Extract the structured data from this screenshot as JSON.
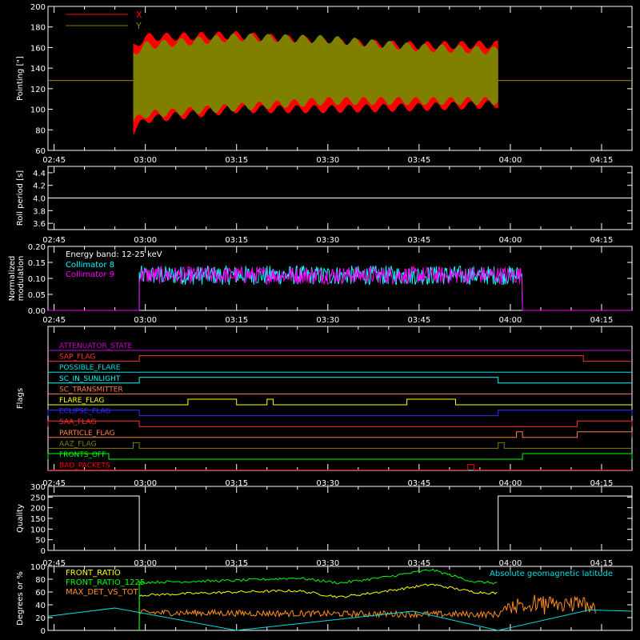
{
  "chart_data": [
    {
      "type": "area",
      "ylabel": "Pointing [\"]",
      "ylim": [
        60,
        200
      ],
      "yticks": [
        60,
        80,
        100,
        120,
        140,
        160,
        180,
        200
      ],
      "x_tick_labels": [
        "02:45",
        "03:00",
        "03:15",
        "03:30",
        "03:45",
        "04:00",
        "04:15"
      ],
      "legend_position": "top-left",
      "series": [
        {
          "name": "X",
          "color": "#ff0000",
          "baseline": 128,
          "envelope": {
            "x": [
              "02:58",
              "03:00",
              "03:15",
              "03:30",
              "03:45",
              "03:58"
            ],
            "upper": [
              160,
              170,
              172,
              165,
              162,
              163
            ],
            "lower": [
              78,
              90,
              100,
              100,
              102,
              105
            ]
          }
        },
        {
          "name": "Y",
          "color": "#808000",
          "baseline": 128,
          "envelope": {
            "x": [
              "02:58",
              "03:00",
              "03:15",
              "03:30",
              "03:45",
              "03:58"
            ],
            "upper": [
              155,
              162,
              170,
              168,
              160,
              157
            ],
            "lower": [
              88,
              95,
              102,
              108,
              108,
              108
            ]
          }
        }
      ]
    },
    {
      "type": "line",
      "ylabel": "Roll period [s]",
      "ylim": [
        3.5,
        4.5
      ],
      "yticks": [
        "3.6",
        "3.8",
        "4.0",
        "4.2",
        "4.4"
      ],
      "x_tick_labels": [
        "02:45",
        "03:00",
        "03:15",
        "03:30",
        "03:45",
        "04:00",
        "04:15"
      ],
      "series": [
        {
          "color": "#ffffff",
          "value": 4.0
        }
      ]
    },
    {
      "type": "line",
      "ylabel": "Normalized modulation",
      "ylim": [
        0,
        0.2
      ],
      "yticks": [
        "0.00",
        "0.05",
        "0.10",
        "0.15",
        "0.20"
      ],
      "x_tick_labels": [
        "02:45",
        "03:00",
        "03:15",
        "03:30",
        "03:45",
        "04:00",
        "04:15"
      ],
      "annotation": "Energy band: 12-25 keV",
      "series": [
        {
          "name": "Collimator 8",
          "color": "#00ffff",
          "mean": 0.11,
          "range": [
            0.08,
            0.19
          ],
          "x_range": [
            "02:59",
            "04:02"
          ]
        },
        {
          "name": "Collimator 9",
          "color": "#ff00ff",
          "mean": 0.11,
          "range": [
            0.07,
            0.17
          ],
          "x_range": [
            "02:59",
            "04:02"
          ]
        }
      ]
    },
    {
      "type": "line",
      "ylabel": "Flags",
      "x_tick_labels": [
        "02:45",
        "03:00",
        "03:15",
        "03:30",
        "03:45",
        "04:00",
        "04:15"
      ],
      "series": [
        {
          "name": "ATTENUATOR_STATE",
          "color": "#cc00cc",
          "steps": []
        },
        {
          "name": "SAP_FLAG",
          "color": "#ff3030",
          "steps": [
            [
              "02:59",
              "04:12"
            ]
          ]
        },
        {
          "name": "POSSIBLE_FLARE",
          "color": "#00e0e0",
          "steps": []
        },
        {
          "name": "SC_IN_SUNLIGHT",
          "color": "#00ffff",
          "steps": [
            [
              "02:59",
              "03:58"
            ]
          ]
        },
        {
          "name": "SC_TRANSMITTER",
          "color": "#ff8040",
          "steps": []
        },
        {
          "name": "FLARE_FLAG",
          "color": "#ffff00",
          "steps": [
            [
              "03:07",
              "03:15"
            ],
            [
              "03:20",
              "03:21"
            ],
            [
              "03:43",
              "03:51"
            ]
          ]
        },
        {
          "name": "ECLIPSE_FLAG",
          "color": "#3030ff",
          "steps": [
            [
              "02:44",
              "02:59"
            ],
            [
              "03:58",
              "04:20"
            ]
          ]
        },
        {
          "name": "SAA_FLAG",
          "color": "#ff3030",
          "steps": [
            [
              "02:44",
              "02:59"
            ],
            [
              "04:11",
              "04:20"
            ]
          ]
        },
        {
          "name": "PARTICLE_FLAG",
          "color": "#ff8040",
          "steps": [
            [
              "04:01",
              "04:02"
            ],
            [
              "04:11",
              "04:20"
            ]
          ]
        },
        {
          "name": "AAZ_FLAG",
          "color": "#808000",
          "steps": [
            [
              "02:58",
              "02:59"
            ],
            [
              "03:58",
              "03:59"
            ]
          ]
        },
        {
          "name": "FRONTS_OFF",
          "color": "#00ff00",
          "steps": [
            [
              "02:44",
              "02:54"
            ],
            [
              "04:02",
              "04:20"
            ]
          ]
        },
        {
          "name": "BAD_PACKETS",
          "color": "#ff0000",
          "steps": [
            [
              "03:53",
              "03:54"
            ]
          ]
        }
      ]
    },
    {
      "type": "line",
      "ylabel": "Quality",
      "ylim": [
        0,
        300
      ],
      "yticks": [
        0,
        50,
        100,
        150,
        200,
        250,
        300
      ],
      "x_tick_labels": [
        "02:45",
        "03:00",
        "03:15",
        "03:30",
        "03:45",
        "04:00",
        "04:15"
      ],
      "series": [
        {
          "color": "#ffffff",
          "x": [
            "02:44",
            "02:59",
            "02:59",
            "03:58",
            "03:58",
            "04:20"
          ],
          "y": [
            255,
            255,
            0,
            0,
            255,
            255
          ]
        }
      ]
    },
    {
      "type": "line",
      "ylabel": "Degrees or %",
      "ylim": [
        0,
        100
      ],
      "yticks": [
        0,
        20,
        40,
        60,
        80,
        100
      ],
      "x_tick_labels": [
        "02:45",
        "03:00",
        "03:15",
        "03:30",
        "03:45",
        "04:00",
        "04:15"
      ],
      "series": [
        {
          "name": "FRONT_RATIO",
          "color": "#ffff00",
          "x": [
            "02:59",
            "03:15",
            "03:25",
            "03:32",
            "03:40",
            "03:47",
            "03:54",
            "03:58"
          ],
          "y": [
            55,
            60,
            62,
            52,
            62,
            72,
            60,
            58
          ]
        },
        {
          "name": "FRONT_RATIO_1225",
          "color": "#00ff00",
          "x": [
            "02:59",
            "03:15",
            "03:25",
            "03:32",
            "03:40",
            "03:47",
            "03:54",
            "03:58"
          ],
          "y": [
            75,
            78,
            82,
            74,
            84,
            95,
            76,
            74
          ]
        },
        {
          "name": "MAX_DET_VS_TOT",
          "color": "#ff9020",
          "x": [
            "02:59",
            "03:30",
            "03:58",
            "04:00",
            "04:14"
          ],
          "y": [
            28,
            26,
            25,
            40,
            40
          ]
        },
        {
          "name": "Absolute geomagnetic latitude",
          "color": "#00e0e0",
          "x": [
            "02:44",
            "02:55",
            "03:15",
            "03:44",
            "03:58",
            "04:13",
            "04:20"
          ],
          "y": [
            22,
            35,
            0,
            30,
            0,
            32,
            30
          ]
        }
      ]
    }
  ]
}
